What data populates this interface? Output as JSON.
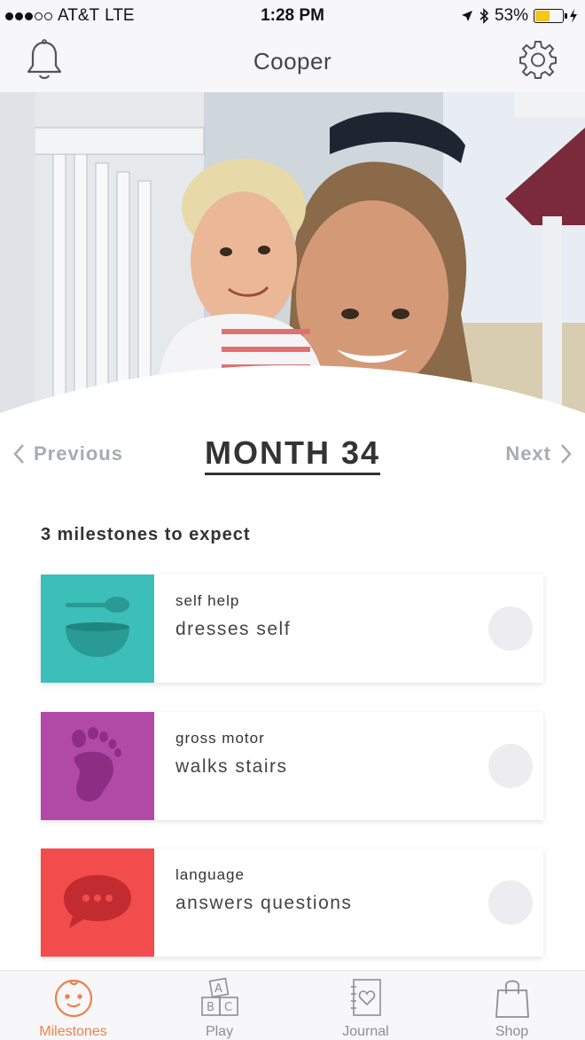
{
  "status_bar": {
    "carrier": "AT&T",
    "network": "LTE",
    "time": "1:28 PM",
    "battery": "53%",
    "battery_level": 0.53
  },
  "header": {
    "title": "Cooper",
    "left_icon": "bell-icon",
    "right_icon": "gear-icon"
  },
  "month_nav": {
    "previous_label": "Previous",
    "next_label": "Next",
    "title": "MONTH 34"
  },
  "milestones": {
    "count_label": "3 milestones to expect",
    "items": [
      {
        "category": "self help",
        "description": "dresses self",
        "color": "#3bbfb8",
        "icon": "bowl-spoon-icon"
      },
      {
        "category": "gross motor",
        "description": "walks stairs",
        "color": "#b04aa6",
        "icon": "footprint-icon"
      },
      {
        "category": "language",
        "description": "answers questions",
        "color": "#f24c4c",
        "icon": "speech-bubble-icon"
      }
    ]
  },
  "tab_bar": {
    "active_color": "#f07f4a",
    "tabs": [
      {
        "label": "Milestones",
        "icon": "baby-face-icon",
        "active": true
      },
      {
        "label": "Play",
        "icon": "abc-blocks-icon",
        "active": false
      },
      {
        "label": "Journal",
        "icon": "journal-heart-icon",
        "active": false
      },
      {
        "label": "Shop",
        "icon": "shopping-bag-icon",
        "active": false
      }
    ]
  }
}
